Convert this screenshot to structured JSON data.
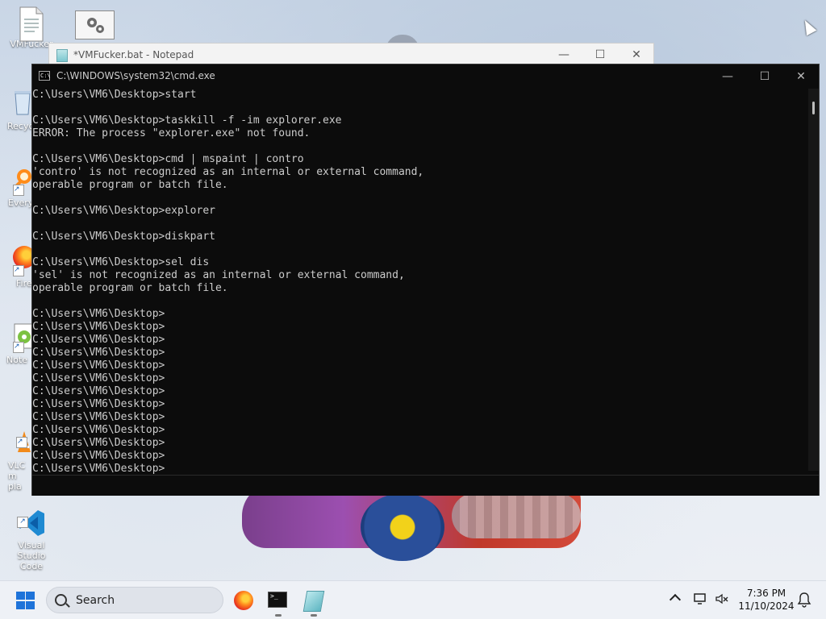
{
  "desktop": {
    "icons": [
      {
        "label": "VMFucker",
        "icon": "batch-file-icon"
      },
      {
        "label": "Recyc",
        "icon": "recycle-bin-icon"
      },
      {
        "label": "Every",
        "icon": "everything-search-icon"
      },
      {
        "label": "Firef",
        "icon": "firefox-icon"
      },
      {
        "label": "Note",
        "icon": "notepad-plus-plus-icon"
      },
      {
        "label": "VLC m\npla",
        "icon": "vlc-icon"
      },
      {
        "label": "Visual Studio\nCode",
        "icon": "vscode-icon"
      }
    ],
    "settings_thumb_icon": "settings-gears-icon"
  },
  "notepad": {
    "title": "*VMFucker.bat - Notepad",
    "minimize": "—",
    "maximize": "☐",
    "close": "✕"
  },
  "cmd": {
    "title": "C:\\WINDOWS\\system32\\cmd.exe",
    "icon_text": "C:\\",
    "minimize": "—",
    "maximize": "☐",
    "close": "✕",
    "lines": [
      "C:\\Users\\VM6\\Desktop>start",
      "",
      "C:\\Users\\VM6\\Desktop>taskkill -f -im explorer.exe",
      "ERROR: The process \"explorer.exe\" not found.",
      "",
      "C:\\Users\\VM6\\Desktop>cmd | mspaint | contro",
      "'contro' is not recognized as an internal or external command,",
      "operable program or batch file.",
      "",
      "C:\\Users\\VM6\\Desktop>explorer",
      "",
      "C:\\Users\\VM6\\Desktop>diskpart",
      "",
      "C:\\Users\\VM6\\Desktop>sel dis",
      "'sel' is not recognized as an internal or external command,",
      "operable program or batch file.",
      "",
      "C:\\Users\\VM6\\Desktop>",
      "C:\\Users\\VM6\\Desktop>",
      "C:\\Users\\VM6\\Desktop>",
      "C:\\Users\\VM6\\Desktop>",
      "C:\\Users\\VM6\\Desktop>",
      "C:\\Users\\VM6\\Desktop>",
      "C:\\Users\\VM6\\Desktop>",
      "C:\\Users\\VM6\\Desktop>",
      "C:\\Users\\VM6\\Desktop>",
      "C:\\Users\\VM6\\Desktop>",
      "C:\\Users\\VM6\\Desktop>",
      "C:\\Users\\VM6\\Desktop>",
      "C:\\Users\\VM6\\Desktop>"
    ]
  },
  "taskbar": {
    "search_label": "Search",
    "time": "7:36 PM",
    "date": "11/10/2024",
    "apps": [
      "firefox-icon",
      "cmd-icon",
      "notepad-icon"
    ],
    "tray_icons": [
      "chevron-up-icon",
      "network-icon",
      "volume-muted-icon",
      "notification-bell-icon"
    ]
  },
  "colors": {
    "cmd_background": "#0c0c0c",
    "cmd_text": "#cccccc",
    "accent": "#1e73d9"
  }
}
